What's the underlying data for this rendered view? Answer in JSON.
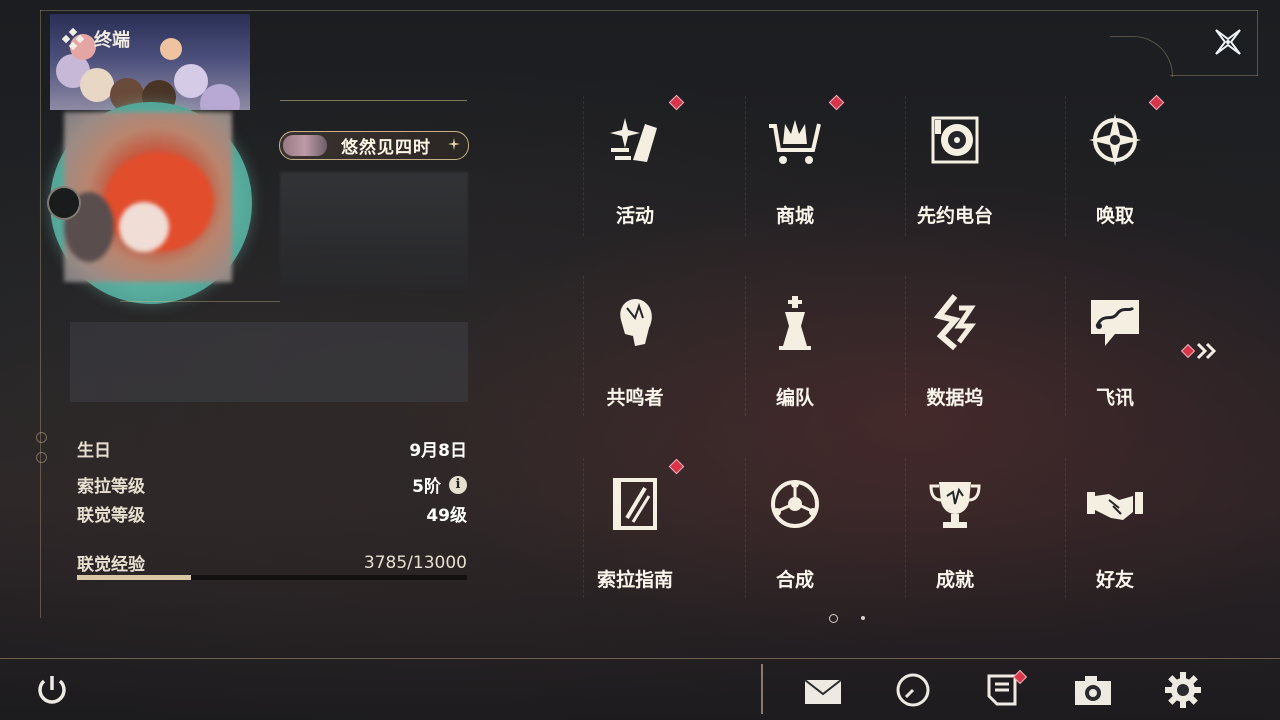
{
  "header": {
    "title": "终端",
    "icon": "diamond-grid-icon"
  },
  "profile": {
    "nickname": "悠然见四时",
    "stats": [
      {
        "label": "生日",
        "value": "9月8日"
      },
      {
        "label": "索拉等级",
        "value": "5阶",
        "info_icon": "i"
      },
      {
        "label": "联觉等级",
        "value": "49级"
      }
    ],
    "experience": {
      "label": "联觉经验",
      "value": "3785/13000",
      "current": 3785,
      "max": 13000
    }
  },
  "menu": {
    "page": 1,
    "page_count": 2,
    "items": [
      {
        "label": "活动",
        "icon": "activity-sparkle-icon",
        "badge": true
      },
      {
        "label": "商城",
        "icon": "shop-cart-icon",
        "badge": true
      },
      {
        "label": "先约电台",
        "icon": "radio-record-icon",
        "badge": false
      },
      {
        "label": "唤取",
        "icon": "summon-star-icon",
        "badge": true
      },
      {
        "label": "共鸣者",
        "icon": "resonator-head-icon",
        "badge": false
      },
      {
        "label": "编队",
        "icon": "chess-team-icon",
        "badge": false
      },
      {
        "label": "数据坞",
        "icon": "data-dock-icon",
        "badge": false
      },
      {
        "label": "飞讯",
        "icon": "chat-message-icon",
        "badge": false
      },
      {
        "label": "索拉指南",
        "icon": "guide-book-icon",
        "badge": true
      },
      {
        "label": "合成",
        "icon": "synthesis-orb-icon",
        "badge": false
      },
      {
        "label": "成就",
        "icon": "trophy-icon",
        "badge": false
      },
      {
        "label": "好友",
        "icon": "handshake-icon",
        "badge": false
      }
    ]
  },
  "bottom_bar": {
    "power": "power-icon",
    "buttons": [
      {
        "icon": "mail-icon",
        "badge": false
      },
      {
        "icon": "clock-icon",
        "badge": false
      },
      {
        "icon": "notes-icon",
        "badge": true
      },
      {
        "icon": "camera-icon",
        "badge": false
      },
      {
        "icon": "settings-gear-icon",
        "badge": false
      }
    ]
  },
  "colors": {
    "accent_gold": "#c8b184",
    "badge_red": "#d8354a",
    "avatar_ring": "#6fbfae"
  }
}
